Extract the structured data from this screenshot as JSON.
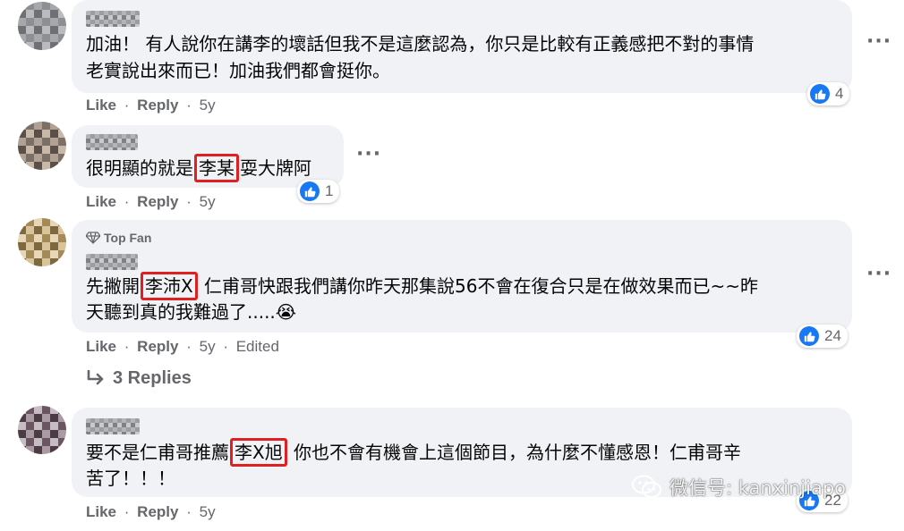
{
  "comments": [
    {
      "text_line1": "加油！ 有人說你在講李的壞話但我不是這麼認為，你只是比較有正義感把不對的事情",
      "text_line2": "老實說出來而已！加油我們都會挺你。",
      "like": "Like",
      "reply": "Reply",
      "age": "5y",
      "reactions": "4"
    },
    {
      "text_pre": "很明顯的就是",
      "text_boxed": "李某",
      "text_post": "耍大牌阿",
      "like": "Like",
      "reply": "Reply",
      "age": "5y",
      "reactions": "1"
    },
    {
      "badge": "Top Fan",
      "text_pre": "先撇開",
      "text_boxed": "李沛X",
      "text_post": " 仁甫哥快跟我們講你昨天那集說56不會在復合只是在做效果而已~~昨",
      "text_line2": "天聽到真的我難過了.....😭",
      "like": "Like",
      "reply": "Reply",
      "age": "5y",
      "edited": "Edited",
      "reactions": "24",
      "replies_label": "3 Replies"
    },
    {
      "text_pre": "要不是仁甫哥推薦",
      "text_boxed": "李X旭",
      "text_post": " 你也不會有機會上這個節目，為什麼不懂感恩！仁甫哥辛",
      "text_line2": "苦了！！！",
      "like": "Like",
      "reply": "Reply",
      "age": "5y",
      "reactions": "22"
    }
  ],
  "separator": "·",
  "more_icon": "···",
  "watermark": {
    "text": "微信号: kanxinjiapo"
  },
  "colors": {
    "bubble": "#f0f2f5",
    "like_blue": "#1877f2",
    "highlight_red": "#e02020",
    "meta_gray": "#65676b"
  }
}
